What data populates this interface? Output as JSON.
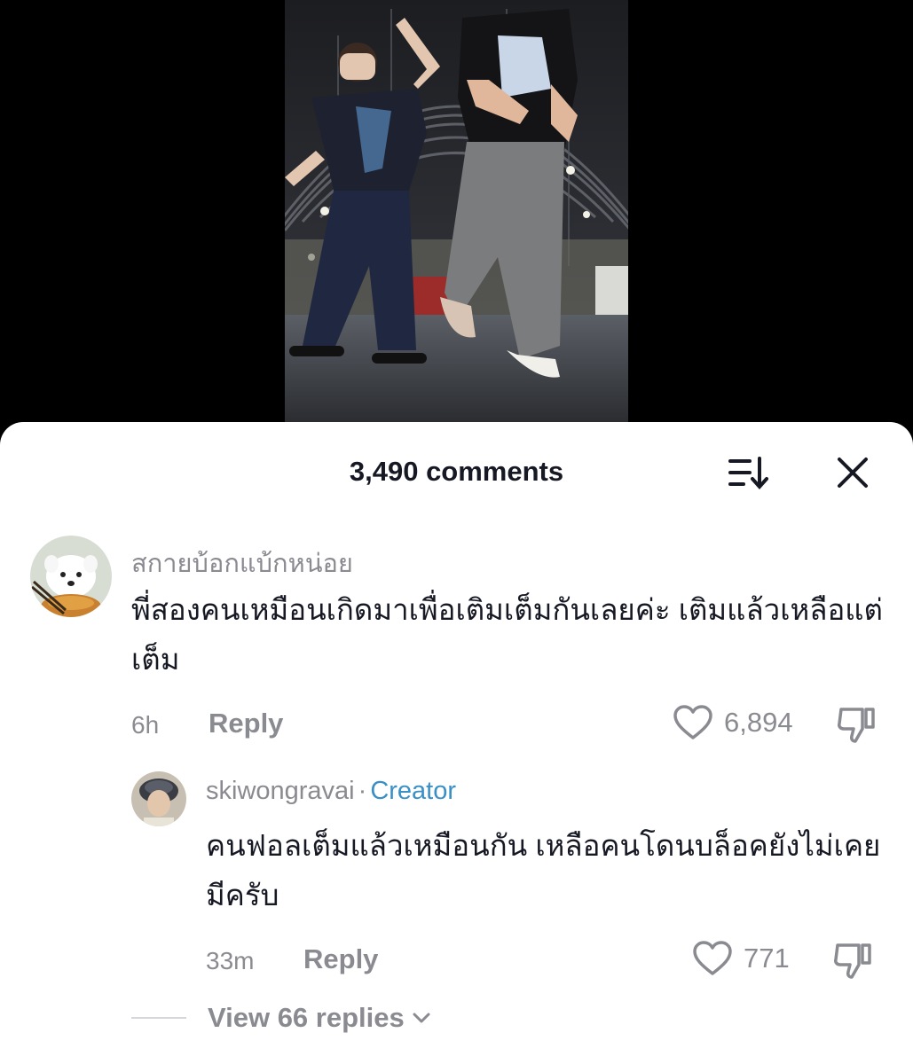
{
  "header": {
    "comment_count": "3,490 comments",
    "sort_icon": "sort-descending-icon",
    "close_icon": "close-icon"
  },
  "comments": [
    {
      "username": "สกายบ้อกแบ้กหน่อย",
      "text": "พี่สองคนเหมือนเกิดมาเพื่อเติมเต็มกันเลยค่ะ เติมแล้วเหลือแต่เต็ม",
      "time": "6h",
      "reply_label": "Reply",
      "likes": "6,894"
    }
  ],
  "reply": {
    "username": "skiwongravai",
    "separator": "·",
    "badge": "Creator",
    "text": "คนฟอลเต็มแล้วเหมือนกัน เหลือคนโดนบล็อคยังไม่เคยมีครับ",
    "time": "33m",
    "reply_label": "Reply",
    "likes": "771"
  },
  "view_replies": "View 66 replies",
  "colors": {
    "accent_creator": "#3a8fc6",
    "text_primary": "#161823",
    "text_secondary": "#8a8b91"
  }
}
